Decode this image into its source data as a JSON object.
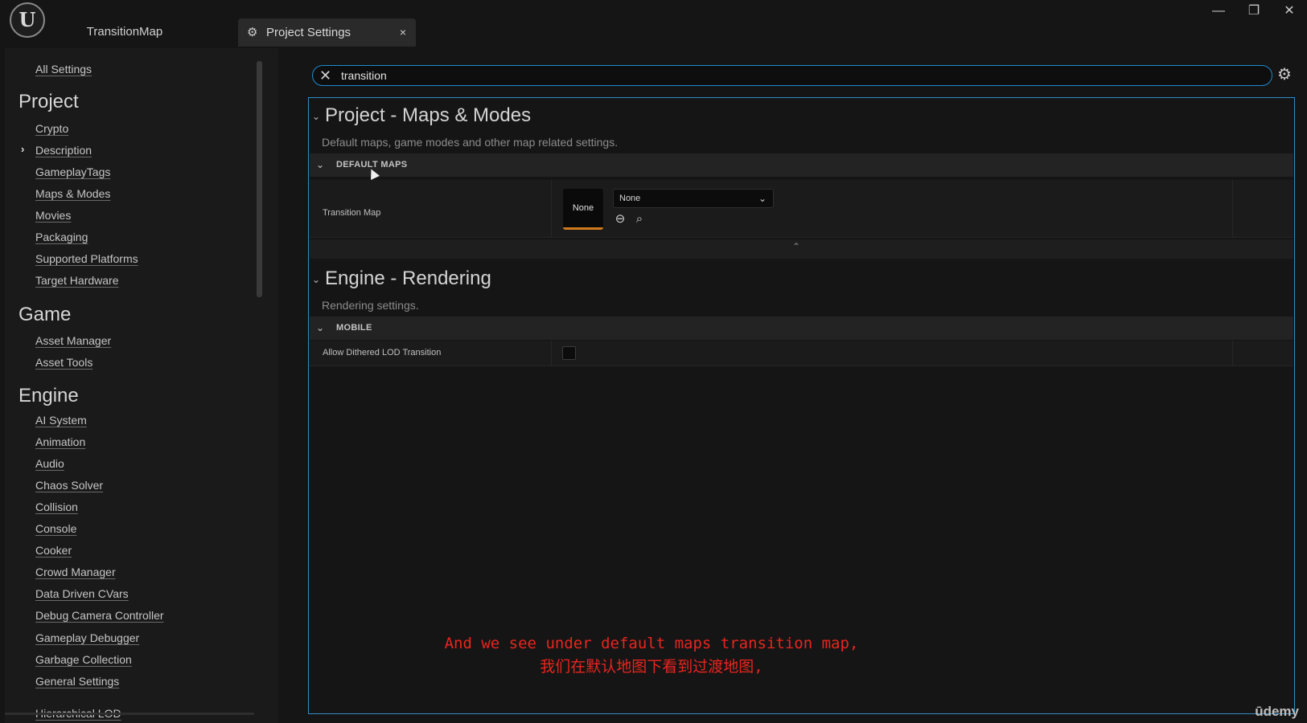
{
  "window": {
    "logo_letter": "U",
    "doc_tab": "TransitionMap",
    "settings_tab": "Project Settings",
    "tab_close": "×",
    "minimize": "—",
    "restore": "❐",
    "close": "✕"
  },
  "sidebar": {
    "all_settings": "All Settings",
    "groups": [
      {
        "heading": "Project",
        "items": [
          "Crypto",
          "Description",
          "GameplayTags",
          "Maps & Modes",
          "Movies",
          "Packaging",
          "Supported Platforms",
          "Target Hardware"
        ]
      },
      {
        "heading": "Game",
        "items": [
          "Asset Manager",
          "Asset Tools"
        ]
      },
      {
        "heading": "Engine",
        "items": [
          "AI System",
          "Animation",
          "Audio",
          "Chaos Solver",
          "Collision",
          "Console",
          "Cooker",
          "Crowd Manager",
          "Data Driven CVars",
          "Debug Camera Controller",
          "Gameplay Debugger",
          "Garbage Collection",
          "General Settings",
          "Hierarchical LOD"
        ]
      }
    ],
    "expanded_item": "Description"
  },
  "search": {
    "value": "transition"
  },
  "sections": {
    "maps": {
      "title": "Project - Maps & Modes",
      "desc": "Default maps, game modes and other map related settings.",
      "category": "DEFAULT MAPS",
      "prop_name": "Transition Map",
      "thumb_label": "None",
      "combo_value": "None"
    },
    "rendering": {
      "title": "Engine - Rendering",
      "desc": "Rendering settings.",
      "category": "MOBILE",
      "prop_name": "Allow Dithered LOD Transition",
      "checked": false
    }
  },
  "subtitles": {
    "en": "And we see under default maps transition map,",
    "zh": "我们在默认地图下看到过渡地图,"
  },
  "watermark": "ūdemy",
  "colors": {
    "accent": "#1e8ad0",
    "asset_underline": "#d07a1e",
    "subtitle": "#e8251f"
  }
}
